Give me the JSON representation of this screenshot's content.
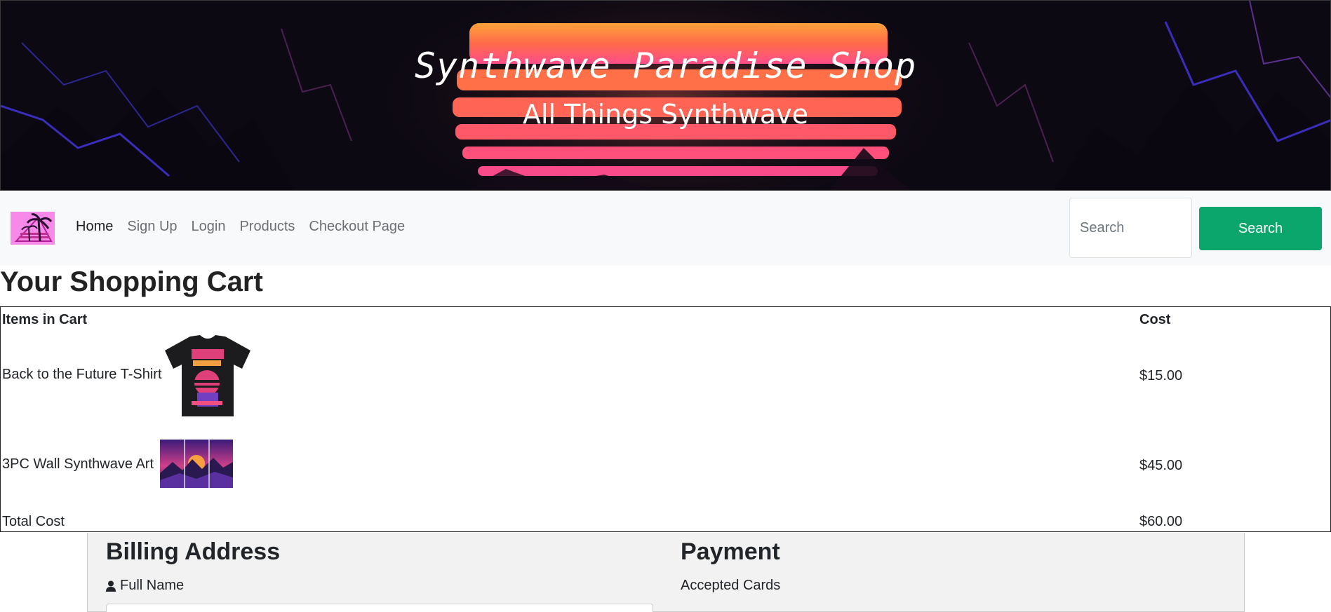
{
  "banner": {
    "title": "Synthwave Paradise Shop",
    "subtitle": "All Things Synthwave"
  },
  "navbar": {
    "links": [
      "Home",
      "Sign Up",
      "Login",
      "Products",
      "Checkout Page"
    ],
    "active_link": "Home",
    "search_placeholder": "Search",
    "search_button": "Search"
  },
  "cart": {
    "heading": "Your Shopping Cart",
    "columns": [
      "Items in Cart",
      "Cost"
    ],
    "items": [
      {
        "name": "Back to the Future T-Shirt",
        "cost": "$15.00",
        "image_icon": "tshirt-image"
      },
      {
        "name": "3PC Wall Synthwave Art",
        "cost": "$45.00",
        "image_icon": "wall-art-image"
      }
    ],
    "total_label": "Total Cost",
    "total_cost": "$60.00"
  },
  "checkout": {
    "billing_heading": "Billing Address",
    "full_name_label": "Full Name",
    "full_name_icon": "user-icon",
    "payment_heading": "Payment",
    "accepted_cards_label": "Accepted Cards"
  },
  "colors": {
    "search_button": "#0ba66b",
    "navbar_bg": "#f8f9fa",
    "logo_bg": "#f78ae8",
    "checkout_bg": "#f2f2f2"
  }
}
